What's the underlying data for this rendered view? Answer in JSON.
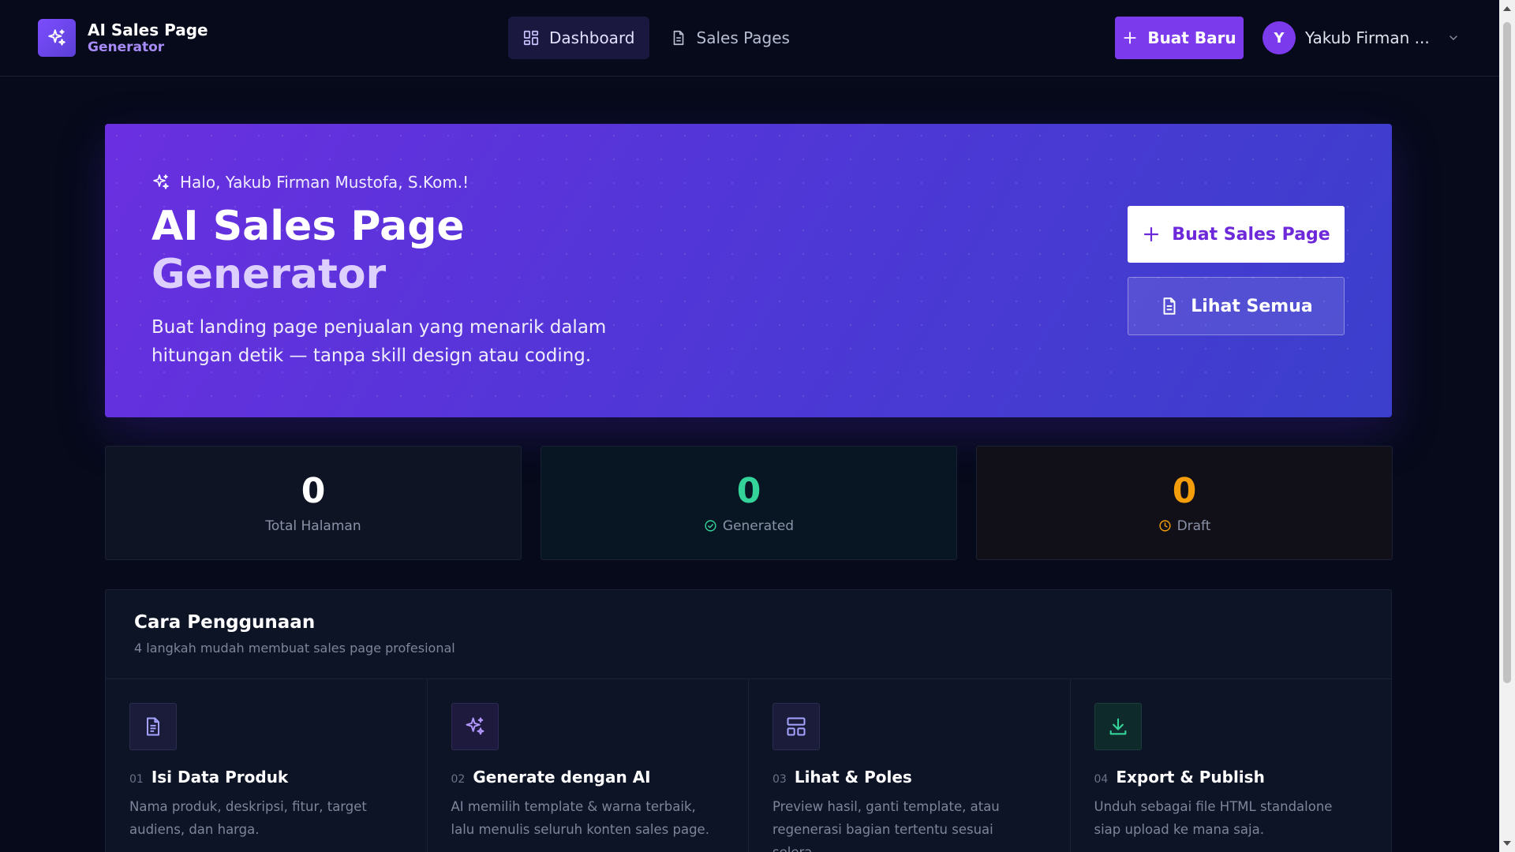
{
  "brand": {
    "title": "AI Sales Page",
    "subtitle": "Generator"
  },
  "nav": [
    {
      "label": "Dashboard",
      "icon": "dashboard-grid-icon",
      "active": true
    },
    {
      "label": "Sales Pages",
      "icon": "document-icon",
      "active": false
    }
  ],
  "header": {
    "new_button": "Buat Baru",
    "user_initial": "Y",
    "user_name": "Yakub Firman ..."
  },
  "hero": {
    "greeting": "Halo, Yakub Firman Mustofa, S.Kom.!",
    "title_line1": "AI Sales Page",
    "title_line2": "Generator",
    "description": "Buat landing page penjualan yang menarik dalam hitungan detik — tanpa skill design atau coding.",
    "primary_button": "Buat Sales Page",
    "secondary_button": "Lihat Semua"
  },
  "stats": [
    {
      "value": "0",
      "label": "Total Halaman",
      "color": "#ffffff",
      "icon": ""
    },
    {
      "value": "0",
      "label": "Generated",
      "color": "#34d399",
      "icon": "check-circle-icon"
    },
    {
      "value": "0",
      "label": "Draft",
      "color": "#f59e0b",
      "icon": "clock-icon"
    }
  ],
  "guide": {
    "title": "Cara Penggunaan",
    "subtitle": "4 langkah mudah membuat sales page profesional",
    "steps": [
      {
        "num": "01",
        "title": "Isi Data Produk",
        "desc": "Nama produk, deskripsi, fitur, target audiens, dan harga.",
        "icon": "document-icon"
      },
      {
        "num": "02",
        "title": "Generate dengan AI",
        "desc": "AI memilih template & warna terbaik, lalu menulis seluruh konten sales page.",
        "icon": "sparkles-icon"
      },
      {
        "num": "03",
        "title": "Lihat & Poles",
        "desc": "Preview hasil, ganti template, atau regenerasi bagian tertentu sesuai selera.",
        "icon": "layout-icon"
      },
      {
        "num": "04",
        "title": "Export & Publish",
        "desc": "Unduh sebagai file HTML standalone siap upload ke mana saja.",
        "icon": "download-icon"
      }
    ]
  },
  "colors": {
    "accent": "#7c3aed",
    "background": "#060a1a",
    "card": "#0d1426"
  }
}
